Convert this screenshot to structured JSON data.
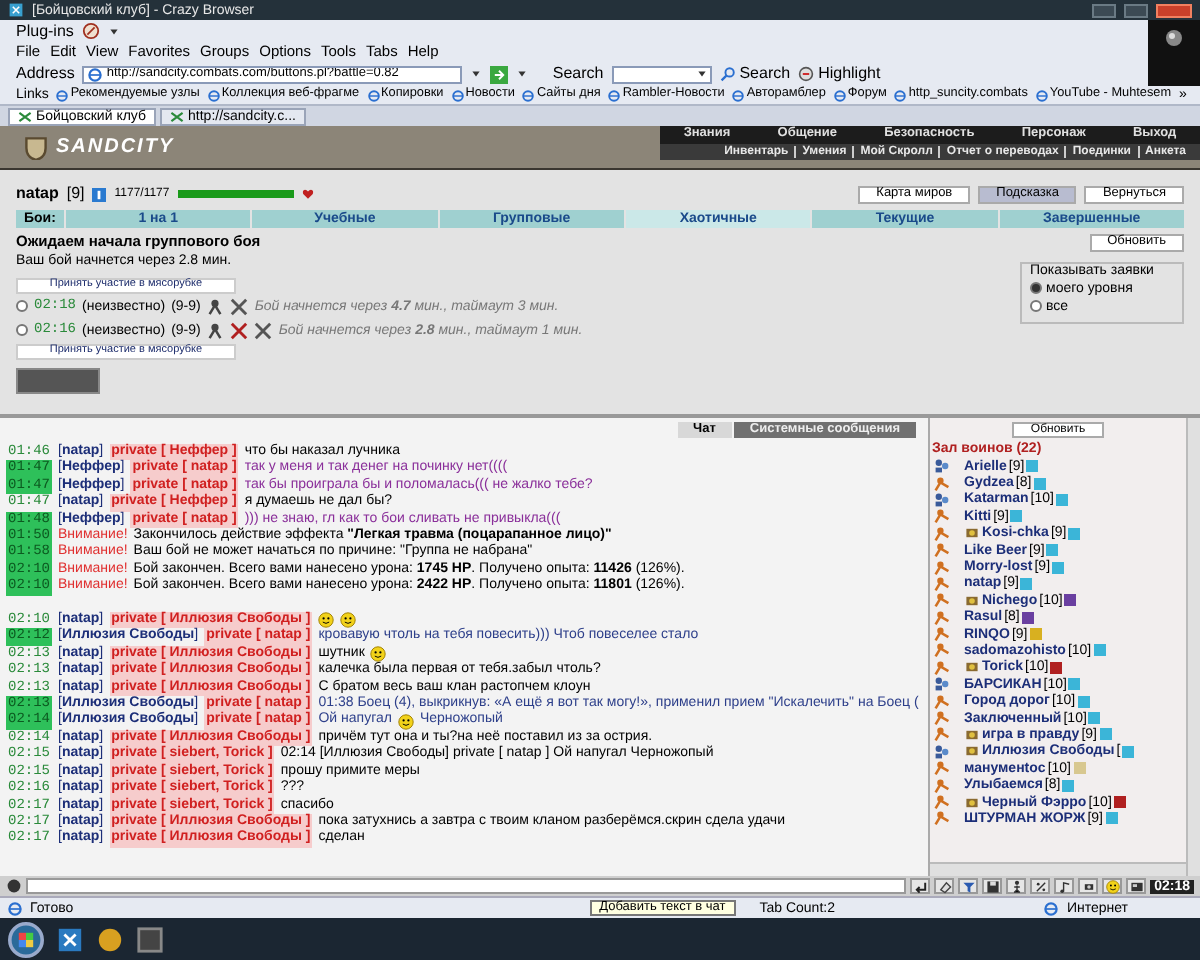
{
  "window": {
    "title": "[Бойцовский клуб] - Crazy Browser"
  },
  "plugins_label": "Plug-ins",
  "menu": [
    "File",
    "Edit",
    "View",
    "Favorites",
    "Groups",
    "Options",
    "Tools",
    "Tabs",
    "Help"
  ],
  "address": {
    "label": "Address",
    "value": "http://sandcity.combats.com/buttons.pl?battle=0.82"
  },
  "search": {
    "label": "Search",
    "button": "Search",
    "highlight": "Highlight"
  },
  "links": {
    "label": "Links",
    "items": [
      "Рекомендуемые узлы",
      "Коллекция веб-фрагме",
      "Копировки",
      "Новости",
      "Сайты дня",
      "Rambler-Новости",
      "Авторамблер",
      "Форум",
      "http_suncity.combats",
      "YouTube - Muhtesem"
    ],
    "more": "»"
  },
  "browser_tabs": [
    {
      "label": "Бойцовский клуб",
      "selected": true
    },
    {
      "label": "http://sandcity.c...",
      "selected": false
    }
  ],
  "game": {
    "logo": "SANDCITY",
    "nav_top": [
      "Знания",
      "Общение",
      "Безопасность",
      "Персонаж",
      "Выход"
    ],
    "nav_bottom": [
      "Инвентарь",
      "Умения",
      "Мой Скролл",
      "Отчет о переводах",
      "Поединки",
      "Анкета"
    ],
    "player": {
      "name": "natap",
      "level": "[9]",
      "hp": "1177/1177",
      "hp_bar": {
        "level": 1
      }
    },
    "buttons": [
      {
        "label": "Карта миров",
        "selected": false
      },
      {
        "label": "Подсказка",
        "selected": true
      },
      {
        "label": "Вернуться",
        "selected": false
      }
    ],
    "battle_tabs": {
      "label": "Бои:",
      "items": [
        {
          "label": "1 на 1",
          "selected": false
        },
        {
          "label": "Учебные",
          "selected": false
        },
        {
          "label": "Групповые",
          "selected": false
        },
        {
          "label": "Хаотичные",
          "selected": true
        },
        {
          "label": "Текущие",
          "selected": false
        },
        {
          "label": "Завершенные",
          "selected": false
        }
      ]
    },
    "status": {
      "title": "Ожидаем начала группового боя",
      "subtitle": "Ваш бой начнется через 2.8 мин.",
      "refresh": "Обновить"
    },
    "join_top": "Принять участие в мясорубке",
    "requests": [
      {
        "selected": false,
        "time": "02:18",
        "who": "(неизвестно)",
        "levels": "(9-9)",
        "icons": [
          {
            "kind": "warrior"
          },
          {
            "kind": "swords"
          }
        ],
        "note": "Бой начнется через **4.7** мин., таймаут 3 мин."
      },
      {
        "selected": false,
        "time": "02:16",
        "who": "(неизвестно)",
        "levels": "(9-9)",
        "icons": [
          {
            "kind": "warrior"
          },
          {
            "kind": "swords-red"
          },
          {
            "kind": "swords"
          }
        ],
        "note": "Бой начнется через **2.8** мин., таймаут 1 мин."
      }
    ],
    "join_bottom": "Принять участие в мясорубке",
    "filter": {
      "title": "Показывать заявки",
      "options": [
        {
          "label": "моего уровня",
          "selected": true
        },
        {
          "label": "все",
          "selected": false
        }
      ]
    }
  },
  "chat": {
    "tabs": [
      {
        "label": "Чат",
        "selected": true
      },
      {
        "label": "Системные сообщения",
        "selected": false
      }
    ],
    "lines": [
      {
        "kind": "private",
        "time": "01:46",
        "highlighted": false,
        "sender": "[**natap**]",
        "recipient": "private [ Неффер ]",
        "text": "что бы наказал лучника",
        "color": "#000000"
      },
      {
        "kind": "private",
        "time": "01:47",
        "highlighted": true,
        "sender": "[**Неффер**]",
        "recipient": "private [ natap ]",
        "text": "так у меня и так денег на починку нет((((",
        "color": "#8a2f9a"
      },
      {
        "kind": "private",
        "time": "01:47",
        "highlighted": true,
        "sender": "[**Неффер**]",
        "recipient": "private [ natap ]",
        "text": "так бы проиграла бы и поломалась((( не жалко тебе?",
        "color": "#8a2f9a"
      },
      {
        "kind": "private",
        "time": "01:47",
        "highlighted": false,
        "sender": "[**natap**]",
        "recipient": "private [ Неффер ]",
        "text": "я думаешь не дал бы?",
        "color": "#000000"
      },
      {
        "kind": "private",
        "time": "01:48",
        "highlighted": true,
        "sender": "[**Неффер**]",
        "recipient": "private [ natap ]",
        "text": "))) не знаю, гл как то бои сливать не привыкла(((",
        "color": "#8a2f9a"
      },
      {
        "kind": "system",
        "time": "01:50",
        "highlighted": true,
        "label": "Внимание!",
        "text": "Закончилось действие эффекта **\"Легкая травма (поцарапанное лицо)\"**"
      },
      {
        "kind": "system",
        "time": "01:58",
        "highlighted": true,
        "label": "Внимание!",
        "text": "Ваш бой не может начаться по причине: \"Группа не набрана\""
      },
      {
        "kind": "system",
        "time": "02:10",
        "highlighted": true,
        "label": "Внимание!",
        "text": "Бой закончен. Всего вами нанесено урона: **1745 HP**. Получено опыта: **11426** (126%)."
      },
      {
        "kind": "system",
        "time": "02:10",
        "highlighted": true,
        "label": "Внимание!",
        "text": "Бой закончен. Всего вами нанесено урона: **2422 HP**. Получено опыта: **11801** (126%)."
      },
      {
        "kind": "blank"
      },
      {
        "kind": "private",
        "time": "02:10",
        "highlighted": false,
        "sender": "[**natap**]",
        "recipient": "private [ Иллюзия Свободы ]",
        "parts": [
          {
            "kind": "smiley"
          },
          {
            "kind": "smiley"
          }
        ]
      },
      {
        "kind": "private",
        "time": "02:12",
        "highlighted": true,
        "sender": "[**Иллюзия Свободы**]",
        "recipient": "private [ natap ]",
        "text": "кровавую чтоль на тебя повесить))) Чтоб повеселее стало",
        "color": "#2d3f8a"
      },
      {
        "kind": "private",
        "time": "02:13",
        "highlighted": false,
        "sender": "[**natap**]",
        "recipient": "private [ Иллюзия Свободы ]",
        "parts": [
          {
            "kind": "text",
            "text": "шутник"
          },
          {
            "kind": "smiley"
          }
        ],
        "color": "#000000"
      },
      {
        "kind": "private",
        "time": "02:13",
        "highlighted": false,
        "sender": "[**natap**]",
        "recipient": "private [ Иллюзия Свободы ]",
        "text": "калечка была первая от тебя.забыл чтоль?",
        "color": "#000000"
      },
      {
        "kind": "private",
        "time": "02:13",
        "highlighted": false,
        "sender": "[**natap**]",
        "recipient": "private [ Иллюзия Свободы ]",
        "text": "С братом весь ваш клан растопчем клоун",
        "color": "#000000"
      },
      {
        "kind": "private",
        "time": "02:13",
        "highlighted": true,
        "sender": "[**Иллюзия Свободы**]",
        "recipient": "private [ natap ]",
        "text": "01:38 Боец (4), выкрикнув: «А ещё я вот так могу!», применил прием \"Искалечить\" на Боец (",
        "color": "#2d3f8a"
      },
      {
        "kind": "private",
        "time": "02:14",
        "highlighted": true,
        "sender": "[**Иллюзия Свободы**]",
        "recipient": "private [ natap ]",
        "parts": [
          {
            "kind": "text",
            "text": "Ой напугал"
          },
          {
            "kind": "smiley"
          },
          {
            "kind": "text",
            "text": "Черножопый"
          }
        ],
        "color": "#2d3f8a"
      },
      {
        "kind": "private",
        "time": "02:14",
        "highlighted": false,
        "sender": "[**natap**]",
        "recipient": "private [ Иллюзия Свободы ]",
        "text": "причём тут она и ты?на неё поставил из за острия.",
        "color": "#000000"
      },
      {
        "kind": "private",
        "time": "02:15",
        "highlighted": false,
        "sender": "[**natap**]",
        "recipient": "private [ siebert, Torick ]",
        "text": "02:14 [Иллюзия Свободы] private [ natap ] Ой напугал Черножопый",
        "color": "#000000"
      },
      {
        "kind": "private",
        "time": "02:15",
        "highlighted": false,
        "sender": "[**natap**]",
        "recipient": "private [ siebert, Torick ]",
        "text": "прошу примите меры",
        "color": "#000000"
      },
      {
        "kind": "private",
        "time": "02:16",
        "highlighted": false,
        "sender": "[**natap**]",
        "recipient": "private [ siebert, Torick ]",
        "text": "???",
        "color": "#000000"
      },
      {
        "kind": "private",
        "time": "02:17",
        "highlighted": false,
        "sender": "[**natap**]",
        "recipient": "private [ siebert, Torick ]",
        "text": "спасибо",
        "color": "#000000"
      },
      {
        "kind": "private",
        "time": "02:17",
        "highlighted": false,
        "sender": "[**natap**]",
        "recipient": "private [ Иллюзия Свободы ]",
        "text": "пока затухнись а завтра с твоим кланом разберёмся.скрин сдела удачи",
        "color": "#000000"
      },
      {
        "kind": "private",
        "time": "02:17",
        "highlighted": false,
        "sender": "[**natap**]",
        "recipient": "private [ Иллюзия Свободы ]",
        "text": "сделан",
        "color": "#000000"
      }
    ],
    "clock": "02:18"
  },
  "warriors": {
    "refresh": "Обновить",
    "title": "Зал воинов (22)",
    "users": [
      {
        "name": "Arielle",
        "level": "[9]",
        "kind": "group",
        "emblem": false,
        "color": "#3bb5d8"
      },
      {
        "name": "Gydzea",
        "level": "[8]",
        "kind": "single",
        "emblem": false,
        "color": "#3bb5d8"
      },
      {
        "name": "Katarman",
        "level": "[10]",
        "kind": "group",
        "emblem": false,
        "color": "#3bb5d8"
      },
      {
        "name": "Kitti",
        "level": "[9]",
        "kind": "single",
        "emblem": false,
        "color": "#3bb5d8"
      },
      {
        "name": "Kosi-chka",
        "level": "[9]",
        "kind": "single",
        "emblem": true,
        "color": "#3bb5d8"
      },
      {
        "name": "Like Beer",
        "level": "[9]",
        "kind": "single",
        "emblem": false,
        "color": "#3bb5d8"
      },
      {
        "name": "Morry-lost",
        "level": "[9]",
        "kind": "single",
        "emblem": false,
        "color": "#3bb5d8"
      },
      {
        "name": "natap",
        "level": "[9]",
        "kind": "single",
        "emblem": false,
        "color": "#3bb5d8"
      },
      {
        "name": "Nichego",
        "level": "[10]",
        "kind": "single",
        "emblem": true,
        "color": "#6a3fa0"
      },
      {
        "name": "Rasul",
        "level": "[8]",
        "kind": "single",
        "emblem": false,
        "color": "#6a3fa0"
      },
      {
        "name": "RINQO",
        "level": "[9]",
        "kind": "single",
        "emblem": false,
        "color": "#d8b020"
      },
      {
        "name": "sadomazohisto",
        "level": "[10]",
        "kind": "single",
        "emblem": false,
        "color": "#3bb5d8"
      },
      {
        "name": "Torick",
        "level": "[10]",
        "kind": "single",
        "emblem": true,
        "color": "#b02020"
      },
      {
        "name": "БАРСИКАН",
        "level": "[10]",
        "kind": "group",
        "emblem": false,
        "color": "#3bb5d8"
      },
      {
        "name": "Город дорог",
        "level": "[10]",
        "kind": "single",
        "emblem": false,
        "color": "#3bb5d8"
      },
      {
        "name": "Заключенный",
        "level": "[10]",
        "kind": "single",
        "emblem": false,
        "color": "#3bb5d8"
      },
      {
        "name": "игра в правду",
        "level": "[9]",
        "kind": "single",
        "emblem": true,
        "color": "#3bb5d8"
      },
      {
        "name": "Иллюзия Свободы",
        "level": "[",
        "kind": "group",
        "emblem": true,
        "color": "#3bb5d8"
      },
      {
        "name": "мануменtoс",
        "level": "[10]",
        "kind": "single",
        "emblem": false,
        "color": "#d8c890"
      },
      {
        "name": "Улыбаемся",
        "level": "[8]",
        "kind": "single",
        "emblem": false,
        "color": "#3bb5d8"
      },
      {
        "name": "Черный Фэрро",
        "level": "[10]",
        "kind": "single",
        "emblem": true,
        "color": "#b02020"
      },
      {
        "name": "ШТУРМАН ЖОРЖ",
        "level": "[9]",
        "kind": "single",
        "emblem": false,
        "color": "#3bb5d8"
      }
    ]
  },
  "status_bar": {
    "ready": "Готово",
    "tooltip": "Добавить текст в чат",
    "tab_count": "Tab Count:2",
    "zone": "Интернет"
  }
}
